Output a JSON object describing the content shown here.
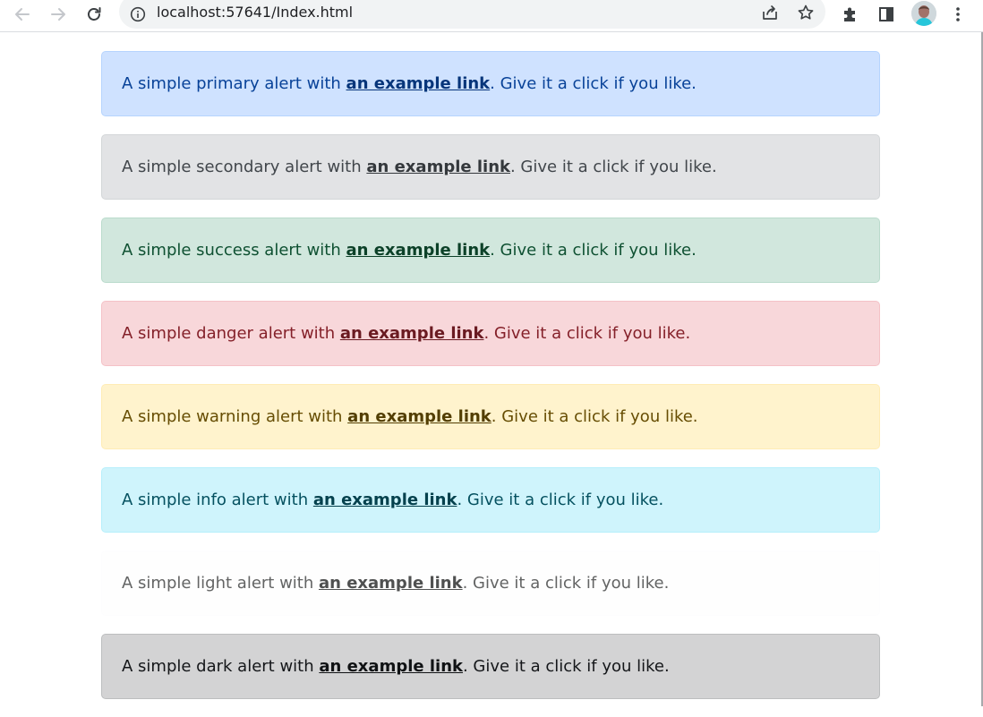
{
  "browser": {
    "url": "localhost:57641/Index.html",
    "icons": {
      "back": "back-arrow-icon",
      "forward": "forward-arrow-icon",
      "reload": "reload-icon",
      "site_info": "info-icon",
      "share": "share-icon",
      "bookmark": "star-icon",
      "extensions": "puzzle-icon",
      "side_panel": "side-panel-icon",
      "profile": "avatar",
      "menu": "kebab-menu-icon"
    }
  },
  "alerts": [
    {
      "variant": "primary",
      "prefix": "A simple primary alert with ",
      "link": "an example link",
      "suffix": ". Give it a click if you like."
    },
    {
      "variant": "secondary",
      "prefix": "A simple secondary alert with ",
      "link": "an example link",
      "suffix": ". Give it a click if you like."
    },
    {
      "variant": "success",
      "prefix": "A simple success alert with ",
      "link": "an example link",
      "suffix": ". Give it a click if you like."
    },
    {
      "variant": "danger",
      "prefix": "A simple danger alert with ",
      "link": "an example link",
      "suffix": ". Give it a click if you like."
    },
    {
      "variant": "warning",
      "prefix": "A simple warning alert with ",
      "link": "an example link",
      "suffix": ". Give it a click if you like."
    },
    {
      "variant": "info",
      "prefix": "A simple info alert with ",
      "link": "an example link",
      "suffix": ". Give it a click if you like."
    },
    {
      "variant": "light",
      "prefix": "A simple light alert with ",
      "link": "an example link",
      "suffix": ". Give it a click if you like."
    },
    {
      "variant": "dark",
      "prefix": "A simple dark alert with ",
      "link": "an example link",
      "suffix": ". Give it a click if you like."
    }
  ],
  "colors": {
    "primary": {
      "bg": "#cfe2ff",
      "text": "#084298"
    },
    "secondary": {
      "bg": "#e2e3e5",
      "text": "#41464b"
    },
    "success": {
      "bg": "#d1e7dd",
      "text": "#0f5132"
    },
    "danger": {
      "bg": "#f8d7da",
      "text": "#842029"
    },
    "warning": {
      "bg": "#fff3cd",
      "text": "#664d03"
    },
    "info": {
      "bg": "#cff4fc",
      "text": "#055160"
    },
    "light": {
      "bg": "#fefefe",
      "text": "#636464"
    },
    "dark": {
      "bg": "#d3d3d4",
      "text": "#141619"
    }
  }
}
